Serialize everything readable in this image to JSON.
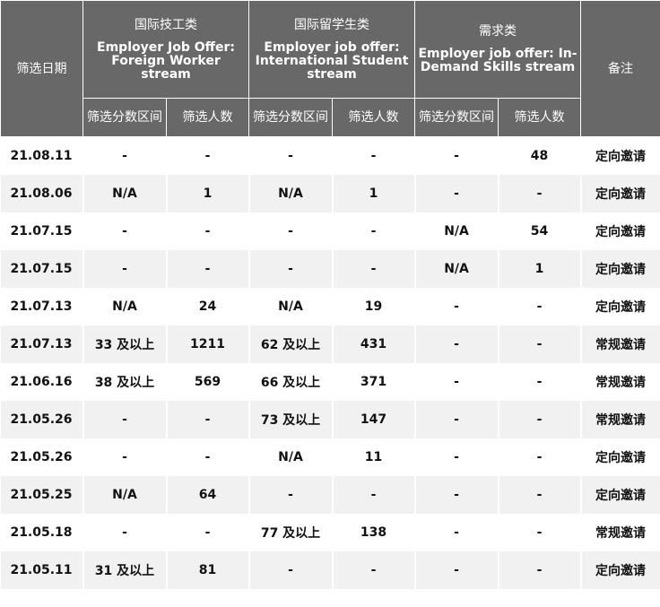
{
  "headers": {
    "date": "筛选日期",
    "note": "备注",
    "groups": [
      {
        "cn": "国际技工类",
        "en": "Employer Job Offer: Foreign Worker stream"
      },
      {
        "cn": "国际留学生类",
        "en": "Employer job offer: International Student stream"
      },
      {
        "cn": "需求类",
        "en": "Employer job offer: In-Demand Skills stream"
      }
    ],
    "sub": {
      "score": "筛选分数区间",
      "count": "筛选人数"
    }
  },
  "rows": [
    {
      "date": "21.08.11",
      "fw_score": "-",
      "fw_count": "-",
      "is_score": "-",
      "is_count": "-",
      "ids_score": "-",
      "ids_count": "48",
      "note": "定向邀请"
    },
    {
      "date": "21.08.06",
      "fw_score": "N/A",
      "fw_count": "1",
      "is_score": "N/A",
      "is_count": "1",
      "ids_score": "-",
      "ids_count": "-",
      "note": "定向邀请"
    },
    {
      "date": "21.07.15",
      "fw_score": "-",
      "fw_count": "-",
      "is_score": "-",
      "is_count": "-",
      "ids_score": "N/A",
      "ids_count": "54",
      "note": "定向邀请"
    },
    {
      "date": "21.07.15",
      "fw_score": "-",
      "fw_count": "-",
      "is_score": "-",
      "is_count": "-",
      "ids_score": "N/A",
      "ids_count": "1",
      "note": "定向邀请"
    },
    {
      "date": "21.07.13",
      "fw_score": "N/A",
      "fw_count": "24",
      "is_score": "N/A",
      "is_count": "19",
      "ids_score": "-",
      "ids_count": "-",
      "note": "定向邀请"
    },
    {
      "date": "21.07.13",
      "fw_score": "33 及以上",
      "fw_count": "1211",
      "is_score": "62 及以上",
      "is_count": "431",
      "ids_score": "-",
      "ids_count": "-",
      "note": "常规邀请"
    },
    {
      "date": "21.06.16",
      "fw_score": "38 及以上",
      "fw_count": "569",
      "is_score": "66 及以上",
      "is_count": "371",
      "ids_score": "-",
      "ids_count": "-",
      "note": "常规邀请"
    },
    {
      "date": "21.05.26",
      "fw_score": "-",
      "fw_count": "-",
      "is_score": "73 及以上",
      "is_count": "147",
      "ids_score": "-",
      "ids_count": "-",
      "note": "常规邀请"
    },
    {
      "date": "21.05.26",
      "fw_score": "-",
      "fw_count": "-",
      "is_score": "N/A",
      "is_count": "11",
      "ids_score": "-",
      "ids_count": "-",
      "note": "定向邀请"
    },
    {
      "date": "21.05.25",
      "fw_score": "N/A",
      "fw_count": "64",
      "is_score": "-",
      "is_count": "-",
      "ids_score": "-",
      "ids_count": "-",
      "note": "定向邀请"
    },
    {
      "date": "21.05.18",
      "fw_score": "-",
      "fw_count": "-",
      "is_score": "77 及以上",
      "is_count": "138",
      "ids_score": "-",
      "ids_count": "-",
      "note": "常规邀请"
    },
    {
      "date": "21.05.11",
      "fw_score": "31 及以上",
      "fw_count": "81",
      "is_score": "-",
      "is_count": "-",
      "ids_score": "-",
      "ids_count": "-",
      "note": "定向邀请"
    }
  ]
}
